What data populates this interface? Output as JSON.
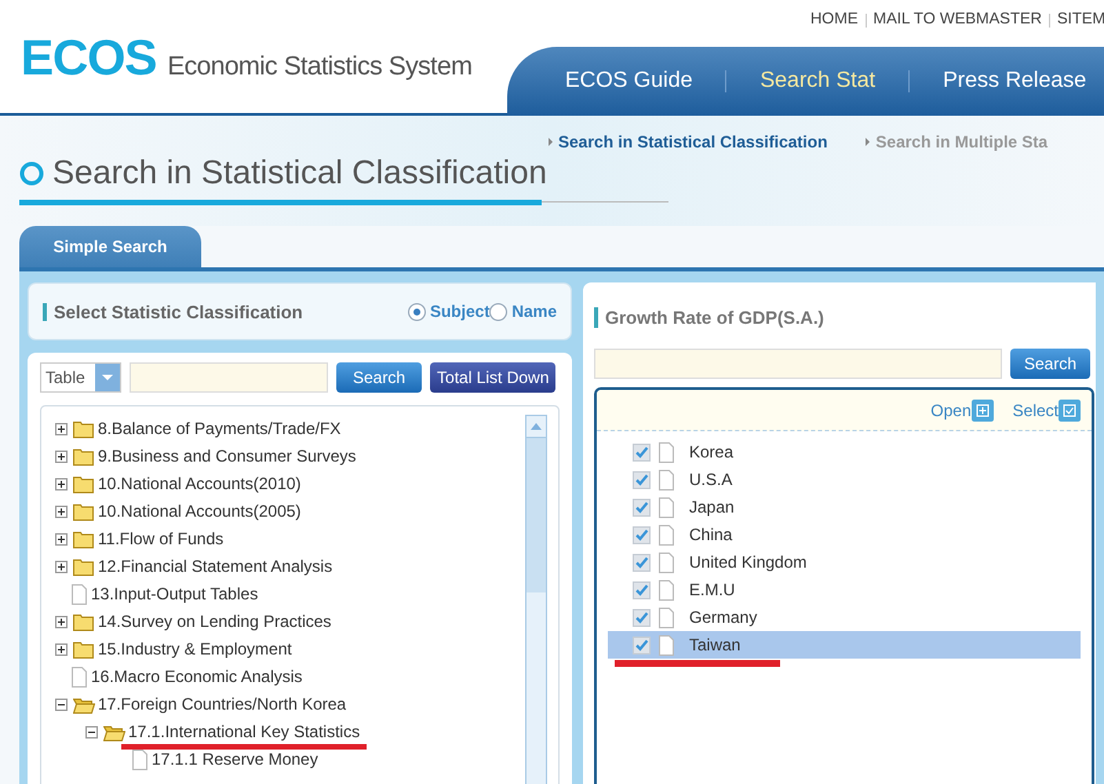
{
  "top_links": [
    "HOME",
    "MAIL TO WEBMASTER",
    "SITEM"
  ],
  "logo": {
    "mark": "ECOS",
    "name": "Economic Statistics System"
  },
  "nav": [
    {
      "label": "ECOS Guide",
      "selected": false
    },
    {
      "label": "Search Stat",
      "selected": true
    },
    {
      "label": "Press Release",
      "selected": false
    }
  ],
  "sub_nav": [
    {
      "label": "Search in Statistical Classification",
      "selected": true
    },
    {
      "label": "Search in Multiple Sta",
      "selected": false
    }
  ],
  "page_title": "Search in Statistical Classification",
  "tabs": [
    {
      "label": "Simple Search",
      "selected": true
    }
  ],
  "classification": {
    "title": "Select Statistic Classification",
    "options": [
      {
        "label": "Subject",
        "selected": true
      },
      {
        "label": "Name",
        "selected": false
      }
    ]
  },
  "search_bar": {
    "type_select": "Table",
    "buttons": [
      "Search",
      "Total List Down"
    ]
  },
  "tree": [
    {
      "label": "8.Balance of Payments/Trade/FX",
      "kind": "folder",
      "expanded": false
    },
    {
      "label": "9.Business and Consumer Surveys",
      "kind": "folder",
      "expanded": false
    },
    {
      "label": "10.National Accounts(2010)",
      "kind": "folder",
      "expanded": false
    },
    {
      "label": "10.National Accounts(2005)",
      "kind": "folder",
      "expanded": false
    },
    {
      "label": "11.Flow of Funds",
      "kind": "folder",
      "expanded": false
    },
    {
      "label": "12.Financial Statement Analysis",
      "kind": "folder",
      "expanded": false
    },
    {
      "label": "13.Input-Output Tables",
      "kind": "document"
    },
    {
      "label": "14.Survey on Lending Practices",
      "kind": "folder",
      "expanded": false
    },
    {
      "label": "15.Industry & Employment",
      "kind": "folder",
      "expanded": false
    },
    {
      "label": "16.Macro Economic Analysis",
      "kind": "document"
    },
    {
      "label": "17.Foreign Countries/North Korea",
      "kind": "folder",
      "expanded": true,
      "children": [
        {
          "label": "17.1.International Key Statistics",
          "kind": "folder",
          "expanded": true,
          "underlined": true,
          "children": [
            {
              "label": "17.1.1 Reserve Money",
              "kind": "document"
            }
          ]
        }
      ]
    }
  ],
  "detail": {
    "title": "Growth Rate of GDP(S.A.)",
    "search_button": "Search",
    "actions": [
      "Open",
      "Select"
    ],
    "items": [
      {
        "label": "Korea",
        "checked": true,
        "selected": false,
        "underlined": false
      },
      {
        "label": "U.S.A",
        "checked": true,
        "selected": false,
        "underlined": false
      },
      {
        "label": "Japan",
        "checked": true,
        "selected": false,
        "underlined": false
      },
      {
        "label": "China",
        "checked": true,
        "selected": false,
        "underlined": false
      },
      {
        "label": "United Kingdom",
        "checked": true,
        "selected": false,
        "underlined": false
      },
      {
        "label": "E.M.U",
        "checked": true,
        "selected": false,
        "underlined": false
      },
      {
        "label": "Germany",
        "checked": true,
        "selected": false,
        "underlined": false
      },
      {
        "label": "Taiwan",
        "checked": true,
        "selected": true,
        "underlined": true
      }
    ]
  }
}
